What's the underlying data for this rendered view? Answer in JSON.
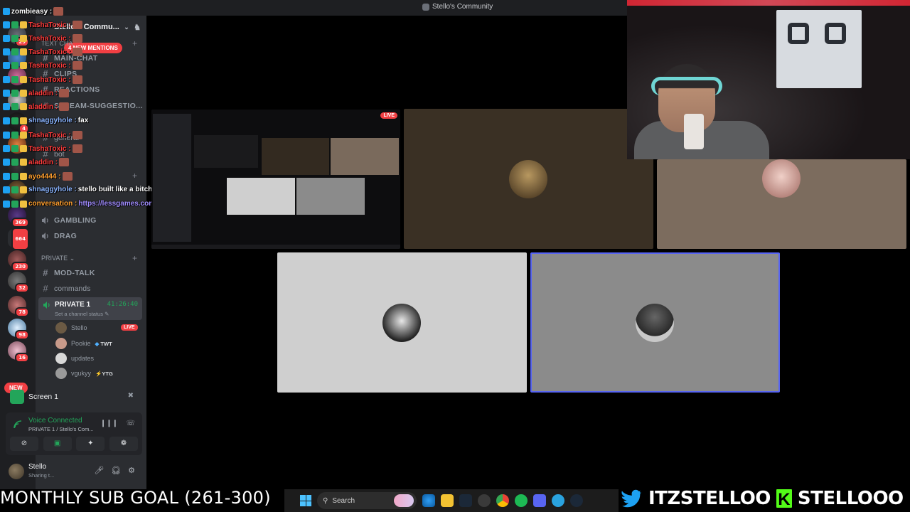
{
  "window": {
    "title": "Stello's Community"
  },
  "server": {
    "name": "Stello's Commu...",
    "mentions_pill": "4 NEW MENTIONS"
  },
  "rail": {
    "badges": [
      "29",
      "4",
      "369",
      "664",
      "230",
      "32",
      "78",
      "98",
      "16"
    ],
    "new_label": "NEW"
  },
  "sidebar": {
    "categories": {
      "text_channels": "text cha",
      "private": "PRIVATE"
    },
    "channels": {
      "main_chat": "MAIN-CHAT",
      "clips": "CLIPS",
      "reactions": "REACTIONS",
      "stream_suggestions": "STREAM-SUGGESTIO...",
      "general": "general",
      "bot": "bot",
      "gambling": "GAMBLING",
      "drag": "DRAG",
      "mod_talk": "MOD-TALK",
      "commands": "commands"
    },
    "voice_channel": {
      "name": "PRIVATE 1",
      "timer": "41:26:40",
      "status": "Set a channel status"
    },
    "voice_users": [
      {
        "name": "Stello",
        "badge": "LIVE",
        "color": "#6b5a44"
      },
      {
        "name": "Pookie",
        "tag": "TWT",
        "color": "#c89a8a"
      },
      {
        "name": "updates",
        "tag": "",
        "color": "#d8d8d8"
      },
      {
        "name": "vgukyy",
        "tag": "YTG",
        "color": "#9a9a9a"
      }
    ]
  },
  "screen_panel": {
    "label": "Screen 1"
  },
  "voice_panel": {
    "status": "Voice Connected",
    "location": "PRIVATE 1 / Stello's Com..."
  },
  "user_panel": {
    "name": "Stello",
    "status": "Sharing t..."
  },
  "chat": [
    {
      "user": "zombieasy",
      "text": "",
      "color": "#ffffff",
      "emote": true
    },
    {
      "user": "TashaToxic",
      "text": "",
      "color": "#ff3b3b",
      "emote": true
    },
    {
      "user": "TashaToxic",
      "text": "",
      "color": "#ff3b3b",
      "emote": true
    },
    {
      "user": "TashaToxic",
      "text": "",
      "color": "#ff3b3b",
      "emote": true
    },
    {
      "user": "TashaToxic",
      "text": "",
      "color": "#ff3b3b",
      "emote": true
    },
    {
      "user": "TashaToxic",
      "text": "",
      "color": "#ff3b3b",
      "emote": true
    },
    {
      "user": "aladdin",
      "text": "",
      "color": "#ff3b3b",
      "emote": true
    },
    {
      "user": "aladdin",
      "text": "",
      "color": "#ff3b3b",
      "emote": true
    },
    {
      "user": "shnaggyhole",
      "text": "fax",
      "color": "#8ab4ff",
      "emote": false
    },
    {
      "user": "TashaToxic",
      "text": "",
      "color": "#ff3b3b",
      "emote": true
    },
    {
      "user": "TashaToxic",
      "text": "",
      "color": "#ff3b3b",
      "emote": true
    },
    {
      "user": "aladdin",
      "text": "",
      "color": "#ff3b3b",
      "emote": true
    },
    {
      "user": "ayo4444",
      "text": "",
      "color": "#ff9f2e",
      "emote": true
    },
    {
      "user": "shnaggyhole",
      "text": "stello built like a bitch",
      "color": "#8ab4ff",
      "emote": false
    },
    {
      "user": "conversation",
      "text": "https://lessgames.com/singles",
      "color": "#ff9f2e",
      "emote": false,
      "link": true
    }
  ],
  "streams": {
    "mini_live": "LIVE",
    "tiles": [
      {
        "bg": "#3a3024",
        "avatar": "#7a6848"
      },
      {
        "bg": "#7c6c5e",
        "avatar": "#d8b0a8"
      },
      {
        "bg": "#cfcfcf",
        "avatar": "#222222"
      },
      {
        "bg": "#8b8b8b",
        "avatar": "#5a5a5a"
      }
    ]
  },
  "overlay": {
    "sub_goal": "MONTHLY SUB GOAL (261-300)",
    "twitter": "ITZSTELLOO",
    "kick": "STELLOOO",
    "kick_letter": "K"
  },
  "taskbar": {
    "search_placeholder": "Search"
  },
  "colors": {
    "accent": "#5865f2",
    "live": "#f23f43",
    "online": "#23a55a"
  }
}
